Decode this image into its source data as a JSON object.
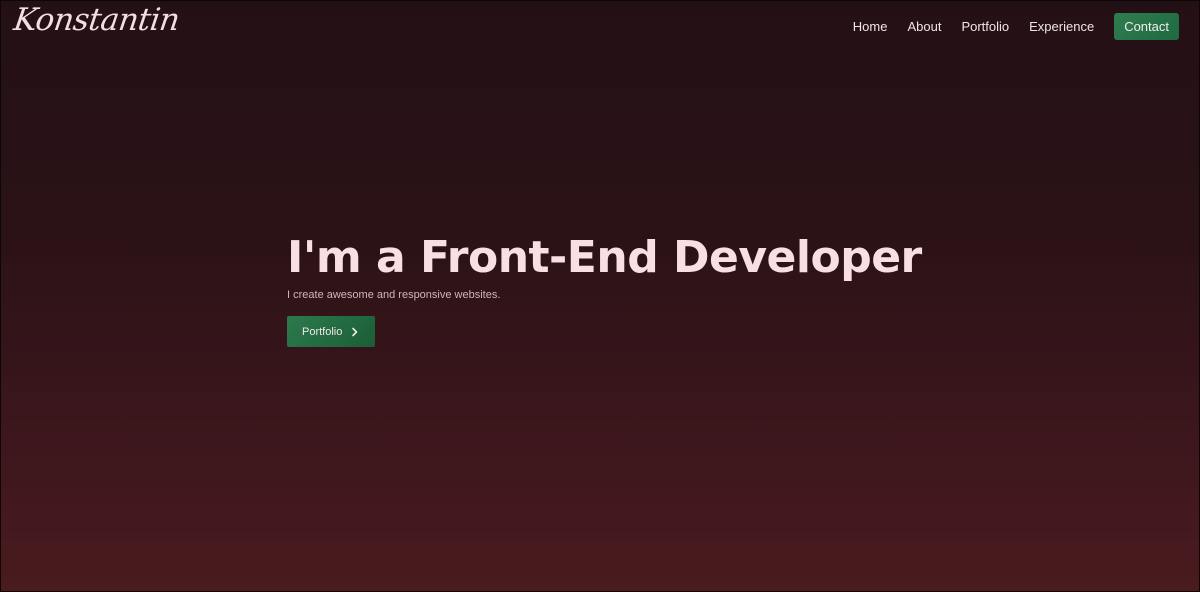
{
  "nav": {
    "logo": "Konstantin",
    "links": [
      "Home",
      "About",
      "Portfolio",
      "Experience"
    ],
    "contact_label": "Contact"
  },
  "hero": {
    "title": "I'm a Front-End Developer",
    "subtitle": "I create awesome and responsive websites.",
    "button_label": "Portfolio",
    "button_icon": "chevron-right-icon"
  },
  "colors": {
    "background_top": "#231015",
    "background_bottom": "#4a1b1f",
    "accent_green": "#2c7a4c",
    "title_color": "#f8dfe3"
  }
}
